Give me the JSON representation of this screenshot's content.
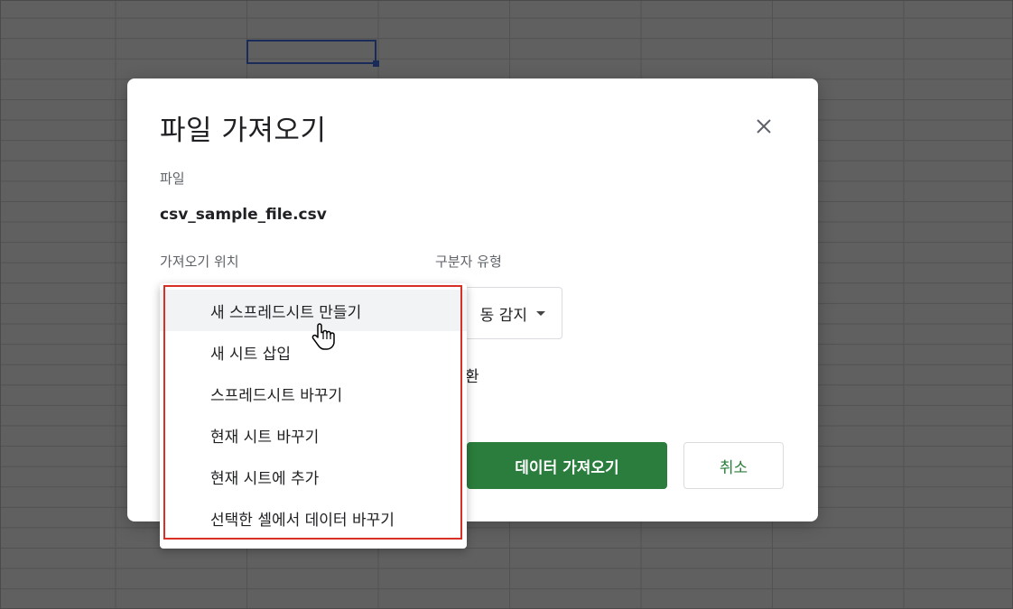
{
  "dialog": {
    "title": "파일 가져오기",
    "file_label": "파일",
    "file_name": "csv_sample_file.csv",
    "import_location_label": "가져오기 위치",
    "separator_label": "구분자 유형",
    "separator_value": "동 감지",
    "convert_text": "환",
    "import_button": "데이터 가져오기",
    "cancel_button": "취소"
  },
  "menu": {
    "items": [
      {
        "label": "새 스프레드시트 만들기"
      },
      {
        "label": "새 시트 삽입"
      },
      {
        "label": "스프레드시트 바꾸기"
      },
      {
        "label": "현재 시트 바꾸기"
      },
      {
        "label": "현재 시트에 추가"
      },
      {
        "label": "선택한 셀에서 데이터 바꾸기"
      }
    ]
  },
  "colors": {
    "primary_green": "#2a7d3c",
    "highlight_red": "#d93025",
    "overlay": "#5f5f5f"
  }
}
